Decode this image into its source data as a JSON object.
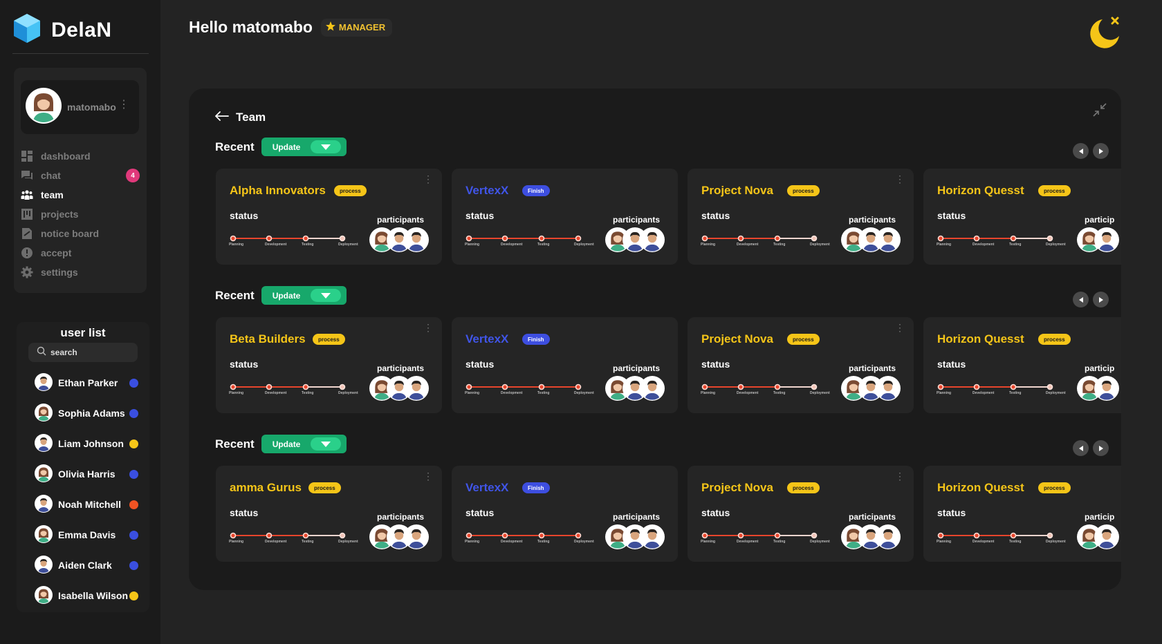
{
  "app": {
    "name": "DelaN",
    "greeting": "Hello matomabo",
    "role_badge": "MANAGER",
    "accent_colors": {
      "process": "#f5c518",
      "finish": "#3d4ee0",
      "update": "#17a86b",
      "tracker": "#e8452c"
    }
  },
  "profile": {
    "name": "matomabo"
  },
  "nav": [
    {
      "label": "dashboard",
      "icon": "dashboard-icon",
      "active": false
    },
    {
      "label": "chat",
      "icon": "chat-icon",
      "active": false,
      "badge": "4"
    },
    {
      "label": "team",
      "icon": "team-icon",
      "active": true
    },
    {
      "label": "projects",
      "icon": "projects-icon",
      "active": false
    },
    {
      "label": "notice board",
      "icon": "notice-board-icon",
      "active": false
    },
    {
      "label": "accept",
      "icon": "accept-icon",
      "active": false
    },
    {
      "label": "settings",
      "icon": "settings-icon",
      "active": false
    }
  ],
  "userlist": {
    "title": "user list",
    "search_placeholder": "search",
    "users": [
      {
        "name": "Ethan Parker",
        "gender": "male",
        "status_color": "#3a4fe0"
      },
      {
        "name": "Sophia Adams",
        "gender": "female",
        "status_color": "#3a4fe0"
      },
      {
        "name": "Liam Johnson",
        "gender": "male",
        "status_color": "#f5c518"
      },
      {
        "name": "Olivia Harris",
        "gender": "female",
        "status_color": "#3a4fe0"
      },
      {
        "name": "Noah Mitchell",
        "gender": "male",
        "status_color": "#ef5323"
      },
      {
        "name": "Emma Davis",
        "gender": "female",
        "status_color": "#3a4fe0"
      },
      {
        "name": "Aiden Clark",
        "gender": "male",
        "status_color": "#3a4fe0"
      },
      {
        "name": "Isabella Wilson",
        "gender": "female",
        "status_color": "#f5c518"
      }
    ]
  },
  "team": {
    "back_label": "Team",
    "stages": [
      "Planning",
      "Development",
      "Testing",
      "Deployment"
    ],
    "status_label": "status",
    "participants_label": "participants",
    "participants_label_truncated": "particip",
    "sections": [
      {
        "title": "Recent",
        "update_label": "Update",
        "cards": [
          {
            "title": "Alpha Innovators",
            "status": "process",
            "kebab": true
          },
          {
            "title": "VertexX",
            "status": "Finish",
            "kebab": false
          },
          {
            "title": "Project Nova",
            "status": "process",
            "kebab": true
          },
          {
            "title": "Horizon Quesst",
            "status": "process",
            "kebab": false
          }
        ]
      },
      {
        "title": "Recent",
        "update_label": "Update",
        "cards": [
          {
            "title": "Beta Builders",
            "status": "process",
            "kebab": true
          },
          {
            "title": "VertexX",
            "status": "Finish",
            "kebab": false
          },
          {
            "title": "Project Nova",
            "status": "process",
            "kebab": true
          },
          {
            "title": "Horizon Quesst",
            "status": "process",
            "kebab": false
          }
        ]
      },
      {
        "title": "Recent",
        "update_label": "Update",
        "cards": [
          {
            "title": "amma Gurus",
            "status": "process",
            "kebab": true
          },
          {
            "title": "VertexX",
            "status": "Finish",
            "kebab": false
          },
          {
            "title": "Project Nova",
            "status": "process",
            "kebab": true
          },
          {
            "title": "Horizon Quesst",
            "status": "process",
            "kebab": false
          }
        ]
      }
    ]
  }
}
